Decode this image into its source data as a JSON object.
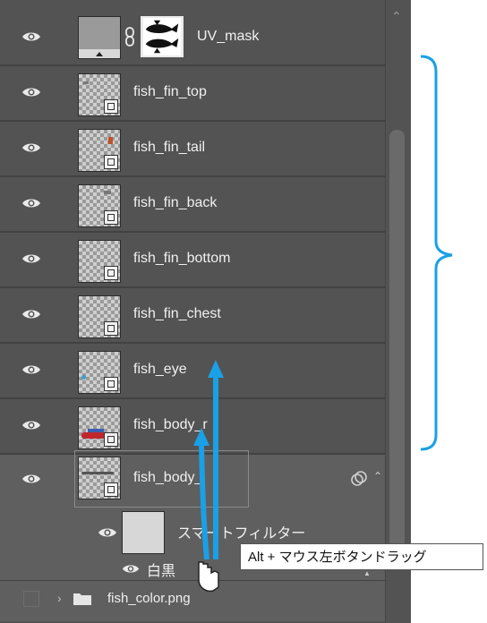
{
  "layers": [
    {
      "name": "UV_mask"
    },
    {
      "name": "fish_fin_top"
    },
    {
      "name": "fish_fin_tail"
    },
    {
      "name": "fish_fin_back"
    },
    {
      "name": "fish_fin_bottom"
    },
    {
      "name": "fish_fin_chest"
    },
    {
      "name": "fish_eye"
    },
    {
      "name": "fish_body_r"
    },
    {
      "name": "fish_body_"
    }
  ],
  "smart_filter": {
    "label": "スマートフィルター",
    "filter_name": "白黒"
  },
  "group": {
    "name": "fish_color.png"
  },
  "tooltip": "Alt + マウス左ボタンドラッグ",
  "colors": {
    "panel_bg": "#535353",
    "annotation_blue": "#1aa0e6",
    "text": "#f0f0f0"
  }
}
